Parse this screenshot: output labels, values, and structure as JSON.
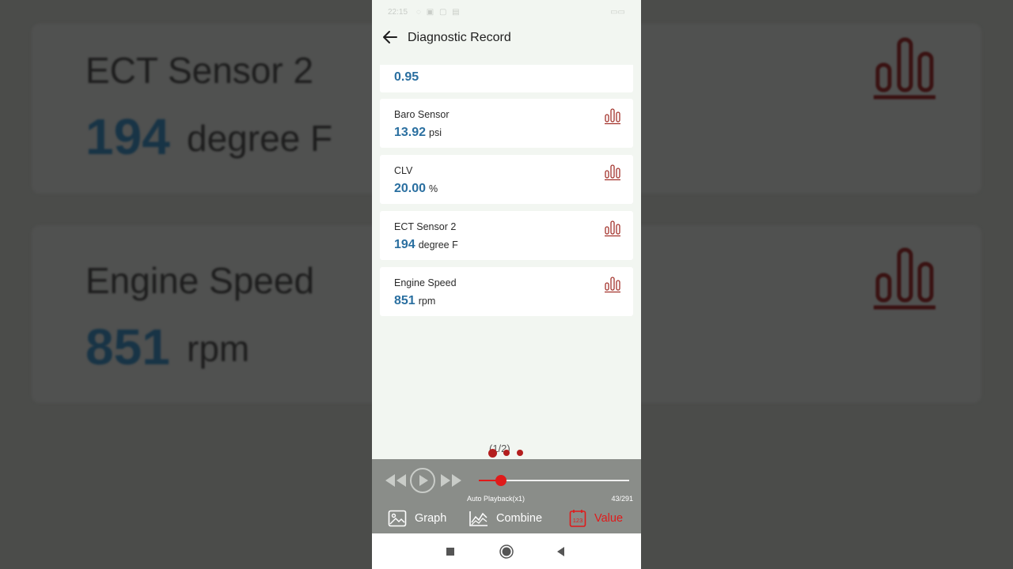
{
  "background": {
    "cards": [
      {
        "label": "ECT Sensor 2",
        "value": "194",
        "unit": "degree F"
      },
      {
        "label": "Engine Speed",
        "value": "851",
        "unit": "rpm"
      }
    ]
  },
  "statusbar": {
    "time": "22:15",
    "icons": "◌ ▣ ▢ ▤",
    "battery": "▭▭"
  },
  "app": {
    "title": "Diagnostic Record"
  },
  "items": [
    {
      "label": "",
      "value": "0.95",
      "unit": ""
    },
    {
      "label": "Baro Sensor",
      "value": "13.92",
      "unit": "psi"
    },
    {
      "label": "CLV",
      "value": "20.00",
      "unit": "%"
    },
    {
      "label": "ECT Sensor 2",
      "value": "194",
      "unit": "degree F"
    },
    {
      "label": "Engine Speed",
      "value": "851",
      "unit": "rpm"
    }
  ],
  "pager": {
    "text": "(1/2)"
  },
  "player": {
    "mode_label": "Auto Playback(x1)",
    "counter": "43/291",
    "position": 43,
    "total": 291
  },
  "tabs": [
    {
      "label": "Graph",
      "icon": "image-icon"
    },
    {
      "label": "Combine",
      "icon": "line-chart-icon"
    },
    {
      "label": "Value",
      "icon": "numeric-value-icon",
      "active": true
    }
  ],
  "colors": {
    "accent": "#e01a1a",
    "value_blue": "#2a6fa0",
    "chart_icon": "#a3332c",
    "player_bg": "#8a8d89"
  }
}
